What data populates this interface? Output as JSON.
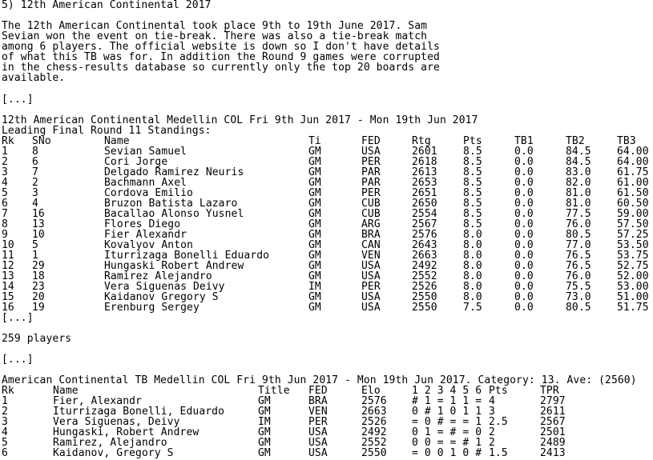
{
  "heading": "5) 12th American Continental 2017",
  "intro": [
    "The 12th American Continental took place 9th to 19th June 2017. Sam",
    "Sevian won the event on tie-break. There was also a tie-break match",
    "among 6 players. The official website is down so I don't have details",
    "of what this TB was for. In addition the Round 9 games were corrupted",
    "in the chess-results database so currently only the top 20 boards are",
    "available."
  ],
  "ellipsis": "[...]",
  "standings": {
    "title": "12th American Continental Medellin COL Fri 9th Jun 2017 - Mon 19th Jun 2017",
    "subtitle": "Leading Final Round 11 Standings:",
    "headers": [
      "Rk",
      "SNo",
      "Name",
      "Ti",
      "FED",
      "Rtg",
      "Pts",
      "TB1",
      "TB2",
      "TB3"
    ],
    "rows": [
      [
        "1",
        "8",
        "Sevian Samuel",
        "GM",
        "USA",
        "2601",
        "8.5",
        "0.0",
        "84.5",
        "64.00"
      ],
      [
        "2",
        "6",
        "Cori Jorge",
        "GM",
        "PER",
        "2618",
        "8.5",
        "0.0",
        "84.5",
        "64.00"
      ],
      [
        "3",
        "7",
        "Delgado Ramirez Neuris",
        "GM",
        "PAR",
        "2613",
        "8.5",
        "0.0",
        "83.0",
        "61.75"
      ],
      [
        "4",
        "2",
        "Bachmann Axel",
        "GM",
        "PAR",
        "2653",
        "8.5",
        "0.0",
        "82.0",
        "61.00"
      ],
      [
        "5",
        "3",
        "Cordova Emilio",
        "GM",
        "PER",
        "2651",
        "8.5",
        "0.0",
        "81.0",
        "61.50"
      ],
      [
        "6",
        "4",
        "Bruzon Batista Lazaro",
        "GM",
        "CUB",
        "2650",
        "8.5",
        "0.0",
        "81.0",
        "60.50"
      ],
      [
        "7",
        "16",
        "Bacallao Alonso Yusnel",
        "GM",
        "CUB",
        "2554",
        "8.5",
        "0.0",
        "77.5",
        "59.00"
      ],
      [
        "8",
        "13",
        "Flores Diego",
        "GM",
        "ARG",
        "2567",
        "8.5",
        "0.0",
        "76.0",
        "57.50"
      ],
      [
        "9",
        "10",
        "Fier Alexandr",
        "GM",
        "BRA",
        "2576",
        "8.0",
        "0.0",
        "80.5",
        "57.25"
      ],
      [
        "10",
        "5",
        "Kovalyov Anton",
        "GM",
        "CAN",
        "2643",
        "8.0",
        "0.0",
        "77.0",
        "53.50"
      ],
      [
        "11",
        "1",
        "Iturrizaga Bonelli Eduardo",
        "GM",
        "VEN",
        "2663",
        "8.0",
        "0.0",
        "76.5",
        "53.75"
      ],
      [
        "12",
        "29",
        "Hungaski Robert Andrew",
        "GM",
        "USA",
        "2492",
        "8.0",
        "0.0",
        "76.5",
        "52.75"
      ],
      [
        "13",
        "18",
        "Ramirez Alejandro",
        "GM",
        "USA",
        "2552",
        "8.0",
        "0.0",
        "76.0",
        "52.00"
      ],
      [
        "14",
        "23",
        "Vera Siguenas Deivy",
        "IM",
        "PER",
        "2526",
        "8.0",
        "0.0",
        "75.5",
        "53.00"
      ],
      [
        "15",
        "20",
        "Kaidanov Gregory S",
        "GM",
        "USA",
        "2550",
        "8.0",
        "0.0",
        "73.0",
        "51.00"
      ],
      [
        "16",
        "19",
        "Erenburg Sergey",
        "GM",
        "USA",
        "2550",
        "7.5",
        "0.0",
        "80.5",
        "51.75"
      ]
    ]
  },
  "players_count": "259 players",
  "tiebreak": {
    "title": "American Continental TB Medellin COL Fri 9th Jun 2017 - Mon 19th Jun 2017. Category: 13. Ave: (2560)",
    "headers": [
      "Rk",
      "Name",
      "Title",
      "FED",
      "Elo",
      "1 2 3 4 5 6",
      "Pts",
      "TPR"
    ],
    "rows": [
      [
        "1",
        "Fier, Alexandr",
        "GM",
        "BRA",
        "2576",
        "# 1 = 1 1 =",
        "4",
        "2797"
      ],
      [
        "2",
        "Iturrizaga Bonelli, Eduardo",
        "GM",
        "VEN",
        "2663",
        "0 # 1 0 1 1",
        "3",
        "2611"
      ],
      [
        "3",
        "Vera Siguenas, Deivy",
        "IM",
        "PER",
        "2526",
        "= 0 # = = 1",
        "2.5",
        "2567"
      ],
      [
        "4",
        "Hungaski, Robert Andrew",
        "GM",
        "USA",
        "2492",
        "0 1 = # = 0",
        "2",
        "2501"
      ],
      [
        "5",
        "Ramirez, Alejandro",
        "GM",
        "USA",
        "2552",
        "0 0 = = # 1",
        "2",
        "2489"
      ],
      [
        "6",
        "Kaidanov, Gregory S",
        "GM",
        "USA",
        "2550",
        "= 0 0 1 0 #",
        "1.5",
        "2413"
      ]
    ]
  }
}
